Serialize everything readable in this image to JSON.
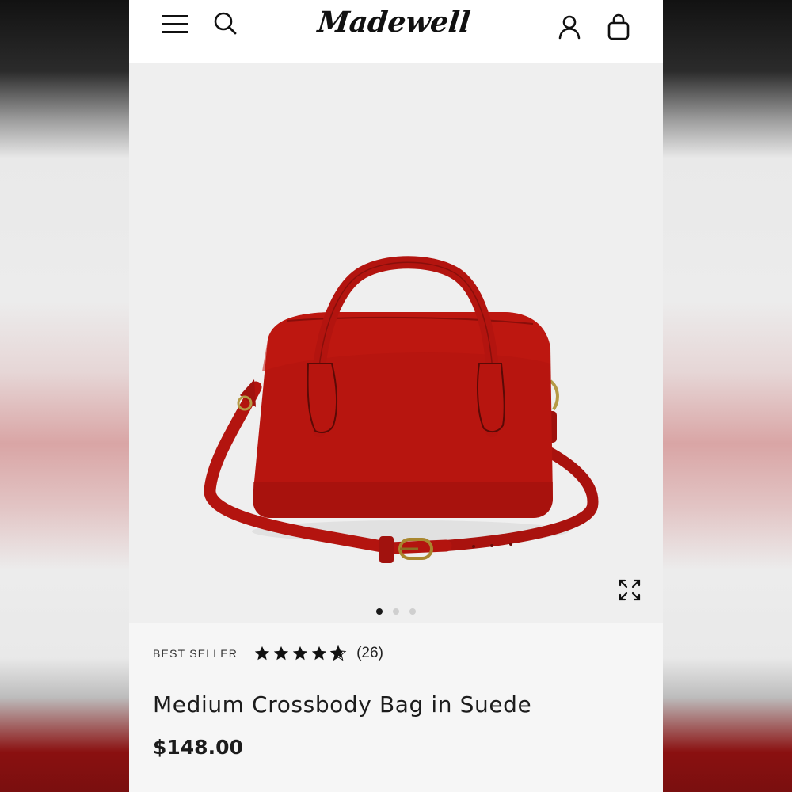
{
  "header": {
    "brand": "Madewell",
    "icons": {
      "menu": "hamburger-menu-icon",
      "search": "search-icon",
      "account": "user-icon",
      "bag": "shopping-bag-icon"
    }
  },
  "gallery": {
    "image_alt": "Medium Crossbody Bag in Suede",
    "image_count": 3,
    "active_index": 0,
    "expand_icon": "expand-icon"
  },
  "product": {
    "badge": "BEST SELLER",
    "rating": 4.5,
    "rating_max": 5,
    "review_count": "(26)",
    "title": "Medium Crossbody Bag in Suede",
    "price": "$148.00"
  },
  "colors": {
    "bag_red": "#b3140f",
    "text": "#1c1c1c",
    "header_bg": "#ffffff",
    "gallery_bg": "#efefef"
  }
}
